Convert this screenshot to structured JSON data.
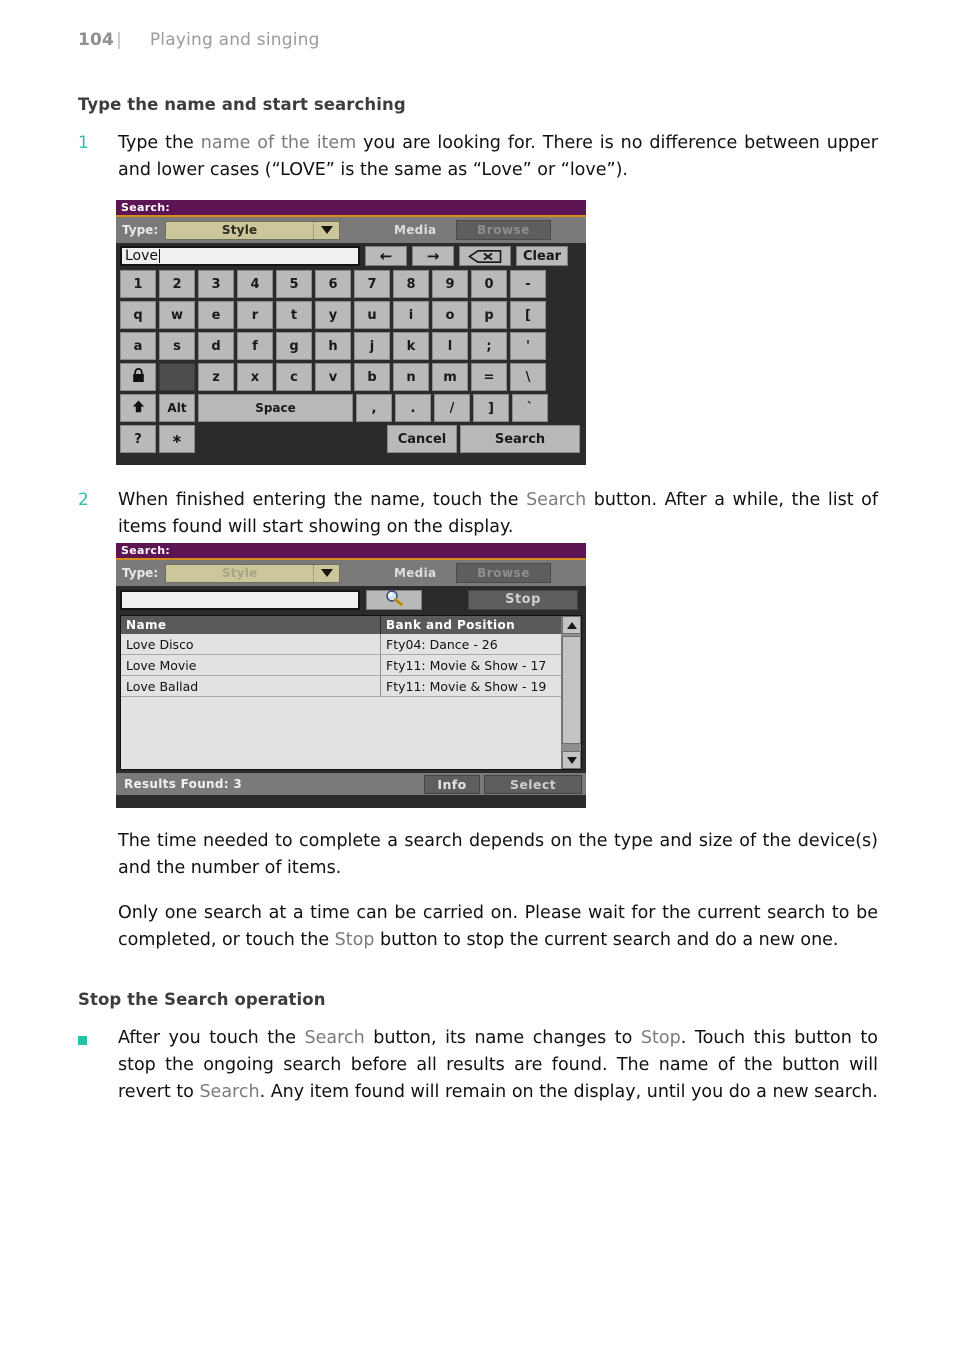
{
  "page": {
    "number": "104",
    "rule": "|",
    "chapter": "Playing and singing"
  },
  "sections": [
    {
      "heading": "Type the name and start searching",
      "step_number": "1",
      "step_text_parts": [
        {
          "t": "Type the ",
          "ui": false
        },
        {
          "t": "name of the item",
          "ui": true
        },
        {
          "t": " you are looking for. There is no difference between upper and lower cases (“LOVE” is the same as “Love” or “love”).",
          "ui": false
        }
      ]
    }
  ],
  "step1": {
    "number": "1",
    "prefix": "Type the ",
    "ui_term": "name of the item",
    "suffix": " you are looking for. There is no difference between upper and lower cases (“LOVE” is the same as “Love” or “love”)."
  },
  "step2": {
    "number": "2",
    "prefix": "When finished entering the name, touch the ",
    "ui_term": "Search",
    "suffix": " button. After a while, the list of items found will start showing on the display."
  },
  "heading1": "Type the name and start searching",
  "heading2": "Stop the Search operation",
  "para1": "The time needed to complete a search depends on the type and size of the device(s) and the number of items.",
  "para2": {
    "prefix": "Only one search at a time can be carried on. Please wait for the current search to be completed, or touch the ",
    "ui_term": "Stop",
    "suffix": " button to stop the current search and do a new one."
  },
  "bullet1": {
    "p1": "After you touch the ",
    "ui1": "Search",
    "p2": " button, its name changes to ",
    "ui2": "Stop",
    "p3": ". Touch this button to stop the ongoing search before all results are found. The name of the button will revert to ",
    "ui3": "Search",
    "p4": ". Any item found will remain on the display, until you do a new search."
  },
  "dialog1": {
    "title": "Search:",
    "type_label": "Type:",
    "type_value": "Style",
    "media_label": "Media",
    "browse_label": "Browse",
    "input_value": "Love",
    "left_arrow": "←",
    "right_arrow": "→",
    "backspace_label": "backspace",
    "clear_label": "Clear",
    "keyboard": {
      "row1": [
        "1",
        "2",
        "3",
        "4",
        "5",
        "6",
        "7",
        "8",
        "9",
        "0",
        "-"
      ],
      "row2": [
        "q",
        "w",
        "e",
        "r",
        "t",
        "y",
        "u",
        "i",
        "o",
        "p",
        "["
      ],
      "row3": [
        "a",
        "s",
        "d",
        "f",
        "g",
        "h",
        "j",
        "k",
        "l",
        ";",
        "'"
      ],
      "row4": [
        "z",
        "x",
        "c",
        "v",
        "b",
        "n",
        "m",
        "=",
        "\\"
      ],
      "row5_right": [
        ",",
        ".",
        "/",
        "]",
        "`"
      ],
      "caps_icon": "lock-icon",
      "shift_icon": "shift-arrow-icon",
      "alt_label": "Alt",
      "space_label": "Space",
      "question_label": "?",
      "star_label": "∗",
      "cancel_label": "Cancel",
      "search_label": "Search"
    }
  },
  "dialog2": {
    "title": "Search:",
    "type_label": "Type:",
    "type_value": "Style",
    "media_label": "Media",
    "browse_label": "Browse",
    "input_value": "",
    "magnifier_icon": "magnifier-icon",
    "stop_label": "Stop",
    "columns": [
      "Name",
      "Bank and Position"
    ],
    "rows": [
      {
        "name": "Love Disco",
        "bank": "Fty04: Dance - 26"
      },
      {
        "name": "Love Movie",
        "bank": "Fty11: Movie & Show - 17"
      },
      {
        "name": "Love Ballad",
        "bank": "Fty11: Movie & Show - 19"
      }
    ],
    "results_found_label": "Results Found:  3",
    "info_label": "Info",
    "select_label": "Select"
  },
  "colors": {
    "accent_teal": "#23c3a6",
    "title_purple": "#5c1452",
    "title_underline_orange": "#d98c1a",
    "dropdown_khaki": "#ccc79a",
    "key_gray": "#b9b9b9",
    "panel_dark": "#2b2b2b"
  }
}
